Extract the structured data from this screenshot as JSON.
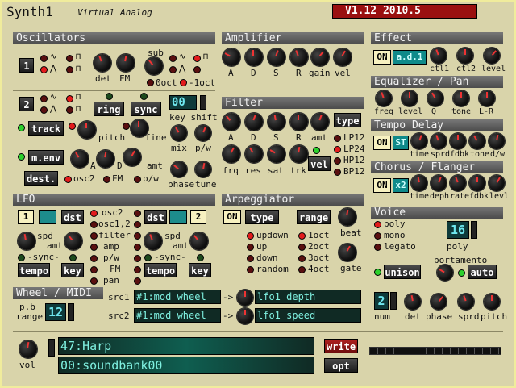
{
  "title": {
    "name": "Synth1",
    "subtitle": "Virtual Analog",
    "version": "V1.12 2010.5"
  },
  "osc": {
    "header": "Oscillators",
    "num1": "1",
    "num2": "2",
    "det": "det",
    "fm": "FM",
    "sub": "sub",
    "oct0": "0oct",
    "oct1": "-1oct",
    "ring": "ring",
    "sync": "sync",
    "track": "track",
    "pitch": "pitch",
    "fine": "fine",
    "key_display": "00",
    "key_shift": "key shift",
    "mix": "mix",
    "pw": "p/w",
    "phase": "phase",
    "tune": "tune",
    "menv": "m.env",
    "a": "A",
    "d": "D",
    "amt": "amt",
    "dest": "dest.",
    "dest_osc2": "osc2",
    "dest_fm": "FM",
    "dest_pw": "p/w"
  },
  "amp": {
    "header": "Amplifier",
    "a": "A",
    "d": "D",
    "s": "S",
    "r": "R",
    "gain": "gain",
    "vel": "vel"
  },
  "filter": {
    "header": "Filter",
    "a": "A",
    "d": "D",
    "s": "S",
    "r": "R",
    "amt": "amt",
    "type": "type",
    "frq": "frq",
    "res": "res",
    "sat": "sat",
    "trk": "trk",
    "vel": "vel",
    "types": [
      "LP12",
      "LP24",
      "HP12",
      "BP12"
    ]
  },
  "effect": {
    "header": "Effect",
    "on": "ON",
    "mode": "a.d.1",
    "ctl1": "ctl1",
    "ctl2": "ctl2",
    "level": "level"
  },
  "eq": {
    "header": "Equalizer / Pan",
    "freq": "freq",
    "level": "level",
    "q": "Q",
    "tone": "tone",
    "lr": "L-R"
  },
  "delay": {
    "header": "Tempo Delay",
    "on": "ON",
    "st": "ST",
    "time": "time",
    "sprd": "sprd",
    "fdbk": "fdbk",
    "tone": "tone",
    "dw": "d/w"
  },
  "chorus": {
    "header": "Chorus / Flanger",
    "on": "ON",
    "mode": "x2",
    "time": "time",
    "deph": "deph",
    "rate": "rate",
    "fdbk": "fdbk",
    "levl": "levl"
  },
  "lfo": {
    "header": "LFO",
    "num1": "1",
    "num2": "2",
    "dst": "dst",
    "spd": "spd",
    "amt": "amt",
    "sync": "-sync-",
    "tempo": "tempo",
    "key": "key",
    "dests": [
      "osc2",
      "osc1,2",
      "filter",
      "amp",
      "p/w",
      "FM",
      "pan"
    ]
  },
  "arp": {
    "header": "Arpeggiator",
    "on": "ON",
    "type": "type",
    "range": "range",
    "beat": "beat",
    "gate": "gate",
    "types": [
      "updown",
      "up",
      "down",
      "random"
    ],
    "ranges": [
      "1oct",
      "2oct",
      "3oct",
      "4oct"
    ]
  },
  "voice": {
    "header": "Voice",
    "modes": [
      "poly",
      "mono",
      "legato"
    ],
    "poly_num": "16",
    "poly": "poly",
    "unison": "unison",
    "portamento": "portamento",
    "auto": "auto",
    "num_val": "2",
    "num": "num",
    "det": "det",
    "phase": "phase",
    "sprd": "sprd",
    "pitch": "pitch"
  },
  "wheel": {
    "header": "Wheel / MIDI",
    "pb": "p.b",
    "range": "range",
    "pb_val": "12",
    "src1": "src1",
    "src2": "src2",
    "src1_val": "#1:mod wheel",
    "src2_val": "#1:mod wheel",
    "arrow": "->",
    "dst1": "lfo1 depth",
    "dst2": "lfo1 speed"
  },
  "patch": {
    "vol": "vol",
    "name": "47:Harp",
    "bank": "00:soundbank00",
    "write": "write",
    "opt": "opt"
  },
  "colors": {
    "bg": "#d9d4aa",
    "header": "#5a5a5a",
    "display": "#102a24",
    "version_bg": "#9a1010"
  }
}
